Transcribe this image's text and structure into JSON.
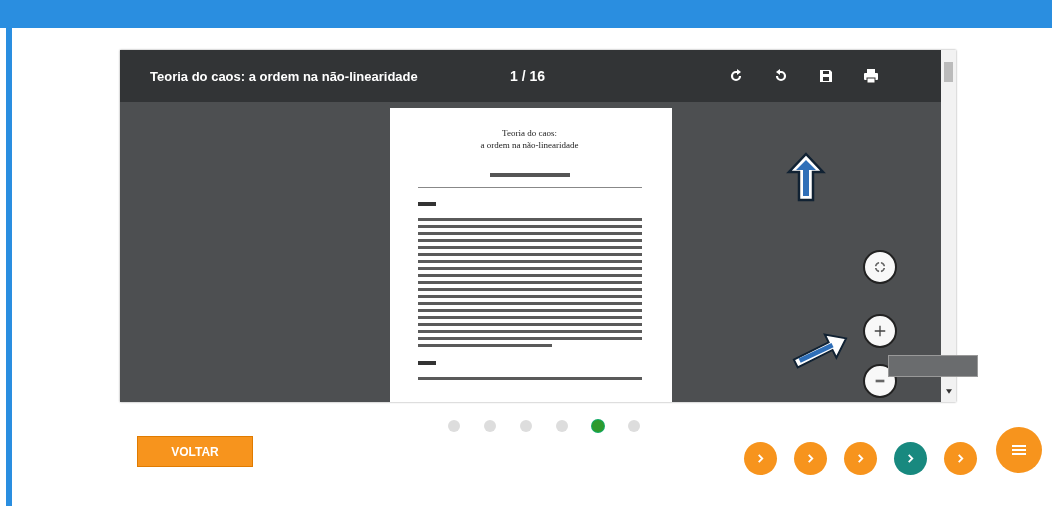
{
  "viewer": {
    "title": "Teoria do caos: a ordem na não-linearidade",
    "page_indicator": "1 / 16",
    "document_page": {
      "title_lines": [
        "Teoria do caos:",
        "a ordem na não-linearidade"
      ]
    }
  },
  "page_dots": [
    {
      "selected": false
    },
    {
      "selected": false
    },
    {
      "selected": false
    },
    {
      "selected": false
    },
    {
      "selected": true
    },
    {
      "selected": false
    }
  ],
  "back_button": {
    "label": "VOLTAR"
  },
  "nav_buttons": [
    {
      "selected": false
    },
    {
      "selected": false
    },
    {
      "selected": false
    },
    {
      "selected": true
    },
    {
      "selected": false
    }
  ]
}
